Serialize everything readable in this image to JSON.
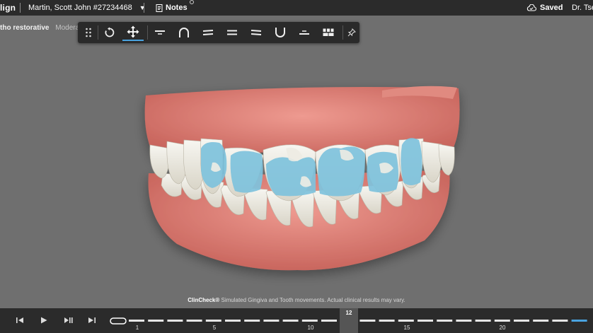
{
  "header": {
    "logo_text": "lign",
    "patient": "Martin, Scott John #27234468",
    "notes_label": "Notes",
    "saved_label": "Saved",
    "doctor": "Dr. Tse"
  },
  "subheader": {
    "plan": "tho restorative",
    "mode": "Moderate"
  },
  "toolbar": {
    "tools": [
      {
        "name": "drag-handle",
        "icon": "grip-icon"
      },
      {
        "name": "rotate",
        "icon": "rotate-icon"
      },
      {
        "name": "move",
        "icon": "move-arrows-icon",
        "active": true
      },
      {
        "name": "view-top",
        "icon": "top-view-icon"
      },
      {
        "name": "view-upper-arch",
        "icon": "upper-arch-icon"
      },
      {
        "name": "view-right",
        "icon": "right-view-icon"
      },
      {
        "name": "view-front",
        "icon": "front-view-icon"
      },
      {
        "name": "view-left",
        "icon": "left-view-icon"
      },
      {
        "name": "view-lower-arch",
        "icon": "lower-arch-icon"
      },
      {
        "name": "view-bottom",
        "icon": "bottom-view-icon"
      },
      {
        "name": "multi-view",
        "icon": "grid-view-icon"
      },
      {
        "name": "pin",
        "icon": "pin-icon"
      }
    ]
  },
  "viewport": {
    "caption_brand": "ClinCheck®",
    "caption_text": "Simulated Gingiva and Tooth movements. Actual clinical results may vary."
  },
  "colors": {
    "gum": "#e3857c",
    "tooth": "#eeece4",
    "attachment": "#7fc3dd",
    "accent": "#4aa3df"
  },
  "timeline": {
    "current_stage": "12",
    "labels": [
      "1",
      "5",
      "10",
      "15",
      "20"
    ],
    "controls": [
      "skip-to-start",
      "play",
      "step-forward",
      "skip-to-end"
    ]
  }
}
